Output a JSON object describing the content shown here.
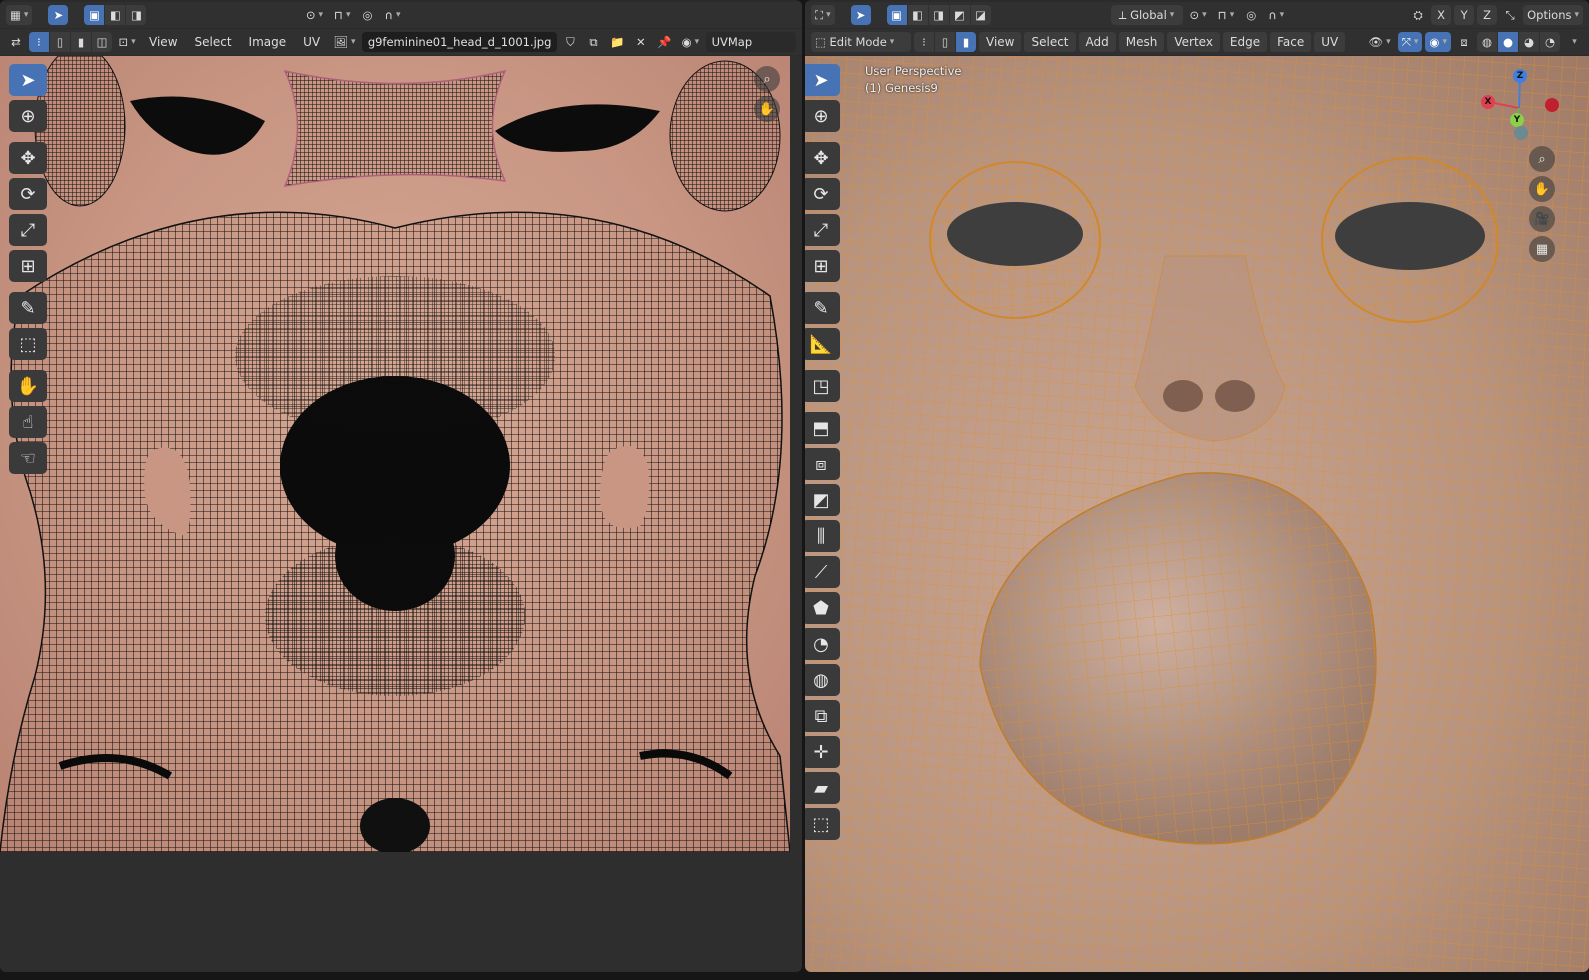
{
  "uv_editor": {
    "header_row1": {
      "editor_type_icon": "uv-editor-icon",
      "select_tool_icon": "cursor-select-icon",
      "selection_modes": [
        "select-new",
        "select-extend",
        "select-subtract"
      ],
      "pivot_icon": "pivot-icon",
      "snap_icon": "snap-icon",
      "proportional_icon": "proportional-edit-icon"
    },
    "header_row2": {
      "sync_icon": "uv-sync-icon",
      "mode_icons": [
        "vertex-mode",
        "edge-mode",
        "face-mode",
        "island-mode"
      ],
      "sticky_icon": "sticky-select-icon",
      "menus": [
        "View",
        "Select",
        "Image",
        "UV"
      ],
      "image_name": "g9feminine01_head_d_1001.jpg",
      "uv_map": "UVMap"
    },
    "tools": [
      "tweak",
      "cursor",
      "move",
      "rotate",
      "scale",
      "transform",
      "annotate",
      "rip",
      "grab",
      "relax",
      "pinch"
    ]
  },
  "viewport": {
    "header_row1": {
      "editor_type_icon": "3d-viewport-icon",
      "transform_orientation": "Global",
      "axes": [
        "X",
        "Y",
        "Z"
      ],
      "options_label": "Options"
    },
    "header_row2": {
      "mode": "Edit Mode",
      "menus": [
        "View",
        "Select",
        "Add",
        "Mesh",
        "Vertex",
        "Edge",
        "Face",
        "UV"
      ]
    },
    "overlay_text": {
      "perspective": "User Perspective",
      "object": "(1) Genesis9"
    },
    "gizmo": {
      "x": "X",
      "y": "Y",
      "z": "Z"
    },
    "tools": [
      "tweak",
      "cursor",
      "move",
      "rotate",
      "scale",
      "transform",
      "annotate",
      "measure",
      "add-cube",
      "extrude",
      "inset",
      "bevel",
      "loop-cut",
      "knife",
      "poly-build",
      "spin",
      "smooth",
      "edge-slide",
      "shrink-fatten",
      "shear",
      "rip-region"
    ]
  },
  "colors": {
    "accent": "#4772b3",
    "wire_uv": "#1a1a1a",
    "wire_3d": "#e0902a",
    "skin": "#c89683"
  }
}
